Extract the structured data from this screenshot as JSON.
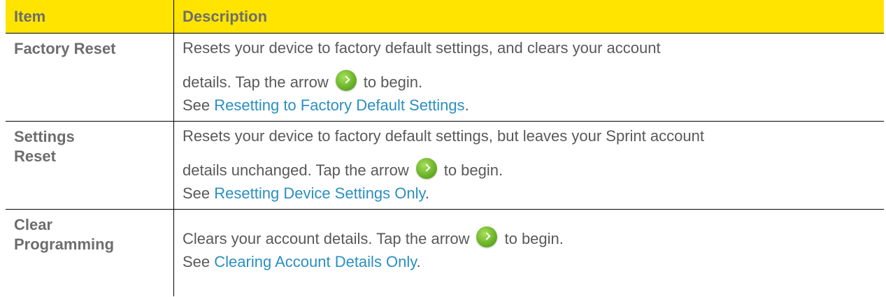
{
  "header": {
    "item": "Item",
    "description": "Description"
  },
  "rows": [
    {
      "item": "Factory Reset",
      "desc_line1": "Resets your device to factory default settings, and clears your account",
      "desc_line2_before": "details. Tap the arrow",
      "desc_line2_after": "to begin.",
      "see": "See ",
      "link": "Resetting to Factory Default Settings",
      "period": "."
    },
    {
      "item_line1": "Settings",
      "item_line2": "Reset",
      "desc_line1": "Resets your device to factory default settings, but leaves your Sprint account",
      "desc_line2_before": "details unchanged. Tap the arrow",
      "desc_line2_after": "to begin.",
      "see": "See ",
      "link": "Resetting Device Settings Only",
      "period": "."
    },
    {
      "item_line1": "Clear",
      "item_line2": "Programming",
      "desc_line1_before": "Clears your account details. Tap the arrow",
      "desc_line1_after": "to begin.",
      "see": "See ",
      "link": "Clearing Account Details Only",
      "period": "."
    }
  ],
  "colors": {
    "header_bg": "#ffe400",
    "link": "#2a8fc0",
    "arrow_icon": "#6cb52a"
  },
  "icons": [
    "arrow-right-circle-icon"
  ]
}
